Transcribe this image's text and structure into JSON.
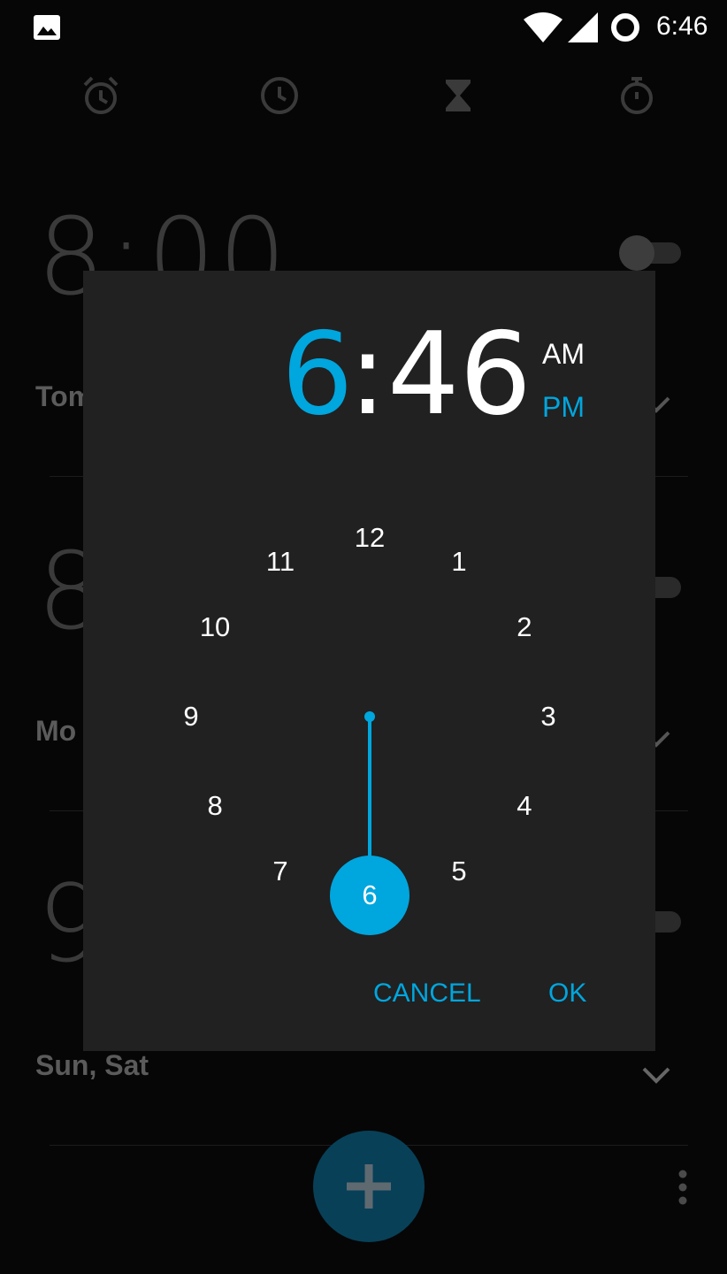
{
  "status_bar": {
    "time": "6:46",
    "icons": [
      "gallery-icon",
      "wifi-icon",
      "cell-signal-icon",
      "battery-icon"
    ]
  },
  "tabs": [
    {
      "icon": "alarm-icon"
    },
    {
      "icon": "clock-icon"
    },
    {
      "icon": "timer-icon"
    },
    {
      "icon": "stopwatch-icon"
    }
  ],
  "alarms": [
    {
      "time": "8:00",
      "days": "Tom"
    },
    {
      "time": "8",
      "days": "Mo"
    },
    {
      "time": "9",
      "days": "Sun, Sat"
    }
  ],
  "dialog": {
    "hour": "6",
    "separator": ":",
    "minute": "46",
    "am_label": "AM",
    "pm_label": "PM",
    "selected_period": "PM",
    "clock_numbers": [
      "12",
      "1",
      "2",
      "3",
      "4",
      "5",
      "6",
      "7",
      "8",
      "9",
      "10",
      "11"
    ],
    "selected_number": "6",
    "cancel_label": "CANCEL",
    "ok_label": "OK"
  },
  "colors": {
    "accent": "#00a6de",
    "dialog_bg": "#212121",
    "background": "#060606",
    "fab": "#084058"
  }
}
